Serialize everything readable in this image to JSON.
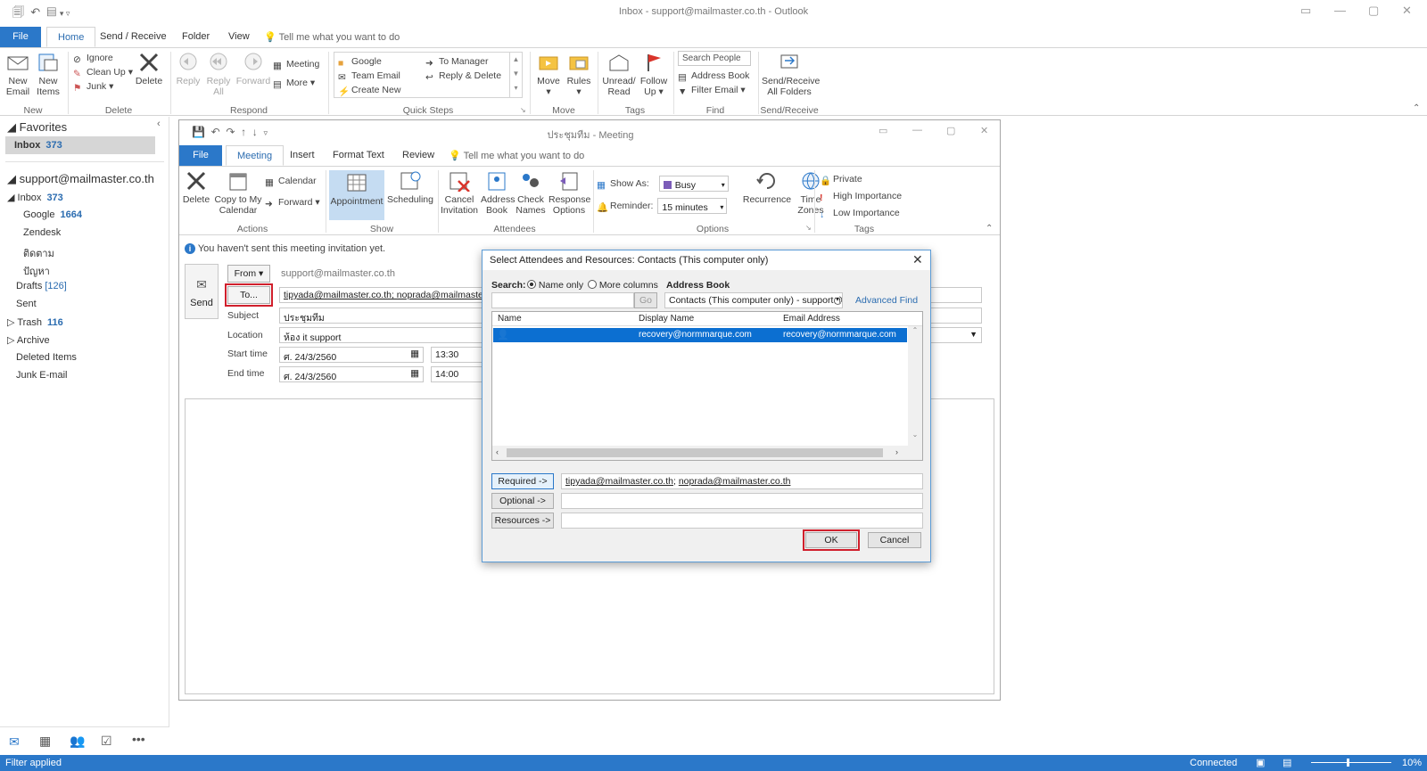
{
  "app": {
    "title": "Inbox - support@mailmaster.co.th  -  Outlook"
  },
  "menu": {
    "tabs": [
      "File",
      "Home",
      "Send / Receive",
      "Folder",
      "View"
    ],
    "tell_me": "Tell me what you want to do"
  },
  "ribbon": {
    "new_email": "New\nEmail",
    "new_items": "New\nItems",
    "ignore": "Ignore",
    "clean_up": "Clean Up",
    "junk": "Junk",
    "delete": "Delete",
    "reply": "Reply",
    "reply_all": "Reply\nAll",
    "forward": "Forward",
    "meeting": "Meeting",
    "more": "More",
    "qs_google": "Google",
    "qs_team": "Team Email",
    "qs_create": "Create New",
    "qs_manager": "To Manager",
    "qs_replydel": "Reply & Delete",
    "move": "Move",
    "rules": "Rules",
    "unread": "Unread/\nRead",
    "follow": "Follow\nUp",
    "search_people": "Search People",
    "address_book": "Address Book",
    "filter_email": "Filter Email",
    "send_receive": "Send/Receive\nAll Folders",
    "groups": [
      "New",
      "Delete",
      "Respond",
      "Quick Steps",
      "Move",
      "Tags",
      "Find",
      "Send/Receive"
    ]
  },
  "nav": {
    "favorites": "Favorites",
    "fav_inbox": "Inbox",
    "fav_inbox_count": "373",
    "account": "support@mailmaster.co.th",
    "folders": [
      {
        "label": "Inbox",
        "count": "373"
      },
      {
        "label": "Google",
        "count": "1664"
      },
      {
        "label": "Zendesk",
        "count": ""
      },
      {
        "label": "ติดตาม",
        "count": ""
      },
      {
        "label": "ปัญหา",
        "count": ""
      },
      {
        "label": "Drafts",
        "count": "[126]"
      },
      {
        "label": "Sent",
        "count": ""
      },
      {
        "label": "Trash",
        "count": "116"
      },
      {
        "label": "Archive",
        "count": ""
      },
      {
        "label": "Deleted Items",
        "count": ""
      },
      {
        "label": "Junk E-mail",
        "count": ""
      }
    ]
  },
  "meeting": {
    "title": "ประชุมทีม  -  Meeting",
    "tabs": [
      "File",
      "Meeting",
      "Insert",
      "Format Text",
      "Review"
    ],
    "tell_me": "Tell me what you want to do",
    "btn_delete": "Delete",
    "btn_copy": "Copy to My\nCalendar",
    "btn_calendar": "Calendar",
    "btn_forward": "Forward",
    "btn_appointment": "Appointment",
    "btn_scheduling": "Scheduling",
    "btn_cancel": "Cancel\nInvitation",
    "btn_addrbook": "Address\nBook",
    "btn_check": "Check\nNames",
    "btn_response": "Response\nOptions",
    "show_as_label": "Show As:",
    "show_as": "Busy",
    "reminder_label": "Reminder:",
    "reminder": "15 minutes",
    "btn_recurrence": "Recurrence",
    "btn_timezones": "Time\nZones",
    "private": "Private",
    "high": "High Importance",
    "low": "Low Importance",
    "groups": [
      "Actions",
      "Show",
      "Attendees",
      "Options",
      "Tags"
    ],
    "info": "You haven't sent this meeting invitation yet.",
    "from_btn": "From",
    "from": "support@mailmaster.co.th",
    "send": "Send",
    "to_btn": "To...",
    "to": "tipyada@mailmaster.co.th; noprada@mailmaster.co.th",
    "subject_label": "Subject",
    "subject": "ประชุมทีม",
    "location_label": "Location",
    "location": "ห้อง it support",
    "start_label": "Start time",
    "start_date": "ศ. 24/3/2560",
    "start_time": "13:30",
    "end_label": "End time",
    "end_date": "ศ. 24/3/2560",
    "end_time": "14:00"
  },
  "dialog": {
    "title": "Select Attendees and Resources: Contacts (This computer only)",
    "search_label": "Search:",
    "name_only": "Name only",
    "more_columns": "More columns",
    "address_book_label": "Address Book",
    "go": "Go",
    "address_book": "Contacts (This computer only) - support@n",
    "advanced_find": "Advanced Find",
    "columns": [
      "Name",
      "Display Name",
      "Email Address"
    ],
    "row": {
      "name": "",
      "display": "recovery@normmarque.com",
      "email": "recovery@normmarque.com"
    },
    "required_btn": "Required ->",
    "required_a": "tipyada@mailmaster.co.th",
    "required_b": "noprada@mailmaster.co.th",
    "optional_btn": "Optional ->",
    "resources_btn": "Resources ->",
    "ok": "OK",
    "cancel": "Cancel"
  },
  "status": {
    "left": "Filter applied",
    "connected": "Connected",
    "zoom": "10%"
  },
  "colors": {
    "accent": "#2b78c9",
    "selection": "#0c6fd1",
    "highlight_box": "#d01f2c"
  }
}
